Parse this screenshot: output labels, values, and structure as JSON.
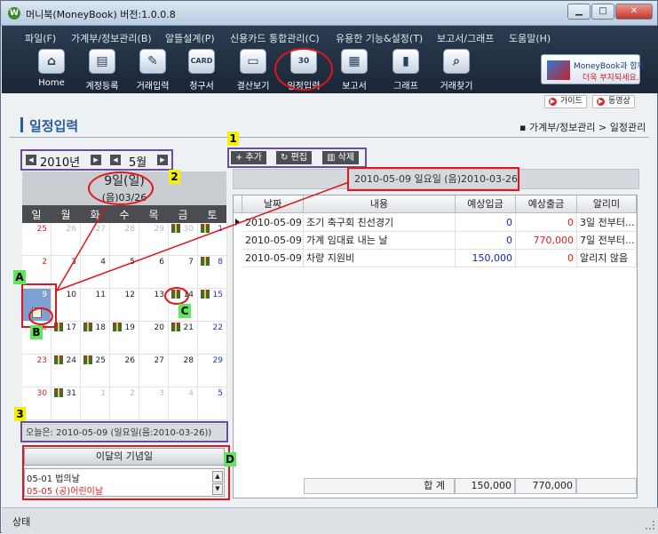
{
  "window": {
    "title": "머니북(MoneyBook) 버전:1.0.0.8",
    "app_icon": "W",
    "controls": [
      "minimize-icon",
      "maximize-icon",
      "close-icon"
    ]
  },
  "menu": [
    "파일(F)",
    "가계부/정보관리(B)",
    "알뜰설계(P)",
    "신용카드 통합관리(C)",
    "유용한 기능&설정(T)",
    "보고서/그래프",
    "도움말(H)"
  ],
  "toolbar": [
    {
      "label": "Home",
      "icon": "home-icon"
    },
    {
      "label": "계정등록",
      "icon": "account-register-icon"
    },
    {
      "label": "거래입력",
      "icon": "transaction-entry-icon"
    },
    {
      "label": "청구서",
      "icon": "card-bill-icon",
      "glyph": "CARD"
    },
    {
      "label": "결산보기",
      "icon": "settlement-icon"
    },
    {
      "label": "일정입력",
      "icon": "schedule-icon",
      "glyph": "30"
    },
    {
      "label": "보고서",
      "icon": "report-icon"
    },
    {
      "label": "그래프",
      "icon": "graph-icon"
    },
    {
      "label": "거래찾기",
      "icon": "search-icon"
    }
  ],
  "brand": {
    "line1": "MoneyBook과 함께",
    "line2": "더욱 부자되세요."
  },
  "help": {
    "guide": "가이드",
    "video": "동영상"
  },
  "page": {
    "title": "일정입력",
    "breadcrumb": "▪ 가계부/정보관리 > 일정관리"
  },
  "calendar": {
    "year": "2010년",
    "month": "5월",
    "selected_day": "9일(일)",
    "selected_lunar": "(음)03/26",
    "weekdays": [
      "일",
      "월",
      "화",
      "수",
      "목",
      "금",
      "토"
    ],
    "weeks": [
      [
        {
          "d": "25",
          "o": true
        },
        {
          "d": "26",
          "o": true
        },
        {
          "d": "27",
          "o": true
        },
        {
          "d": "28",
          "o": true
        },
        {
          "d": "29",
          "o": true
        },
        {
          "d": "30",
          "o": true,
          "g": true
        },
        {
          "d": "1",
          "g": true
        }
      ],
      [
        {
          "d": "2"
        },
        {
          "d": "3"
        },
        {
          "d": "4"
        },
        {
          "d": "5"
        },
        {
          "d": "6"
        },
        {
          "d": "7"
        },
        {
          "d": "8",
          "g": true
        }
      ],
      [
        {
          "d": "9",
          "s": true,
          "memo": true
        },
        {
          "d": "10"
        },
        {
          "d": "11"
        },
        {
          "d": "12"
        },
        {
          "d": "13"
        },
        {
          "d": "14",
          "g": true
        },
        {
          "d": "15",
          "g": true
        }
      ],
      [
        {
          "d": "16"
        },
        {
          "d": "17",
          "g": true
        },
        {
          "d": "18",
          "g": true
        },
        {
          "d": "19",
          "g": true
        },
        {
          "d": "20"
        },
        {
          "d": "21",
          "g": true
        },
        {
          "d": "22"
        }
      ],
      [
        {
          "d": "23"
        },
        {
          "d": "24",
          "g": true
        },
        {
          "d": "25",
          "g": true
        },
        {
          "d": "26"
        },
        {
          "d": "27"
        },
        {
          "d": "28"
        },
        {
          "d": "29"
        }
      ],
      [
        {
          "d": "30"
        },
        {
          "d": "31",
          "g": true
        },
        {
          "d": "1",
          "o": true
        },
        {
          "d": "2",
          "o": true
        },
        {
          "d": "3",
          "o": true
        },
        {
          "d": "4",
          "o": true
        },
        {
          "d": "5",
          "o": true
        }
      ]
    ],
    "today": "오늘은:  2010-05-09  (일요일(음:2010-03-26))"
  },
  "anniversaries": {
    "title": "이달의 기념일",
    "items": [
      {
        "text": "05-01 법의날",
        "color": "#222222"
      },
      {
        "text": "05-05 (공)어린이날",
        "color": "#d81f1f"
      }
    ]
  },
  "actions": {
    "add": "+ 추가",
    "edit": "편집",
    "delete": "삭제"
  },
  "schedule": {
    "date_header": "2010-05-09 일요일 (음)2010-03-26",
    "columns": [
      "날짜",
      "내용",
      "예상입금",
      "예상출금",
      "알리미"
    ],
    "rows": [
      {
        "date": "2010-05-09",
        "content": "조기 축구회 친선경기",
        "in": "0",
        "out": "0",
        "alarm": "3일 전부터..."
      },
      {
        "date": "2010-05-09",
        "content": "가계 임대료 내는 날",
        "in": "0",
        "out": "770,000",
        "alarm": "7일 전부터..."
      },
      {
        "date": "2010-05-09",
        "content": "차량 지원비",
        "in": "150,000",
        "out": "0",
        "alarm": "알리지 않음"
      }
    ],
    "total_label": "합 계",
    "total_in": "150,000",
    "total_out": "770,000"
  },
  "status": "상태",
  "annotations": {
    "tag1": "1",
    "tag2": "2",
    "tag3": "3",
    "tagA": "A",
    "tagB": "B",
    "tagC": "C",
    "tagD": "D",
    "annotation_color": "#e3141b",
    "marker_color": "#f5f000",
    "marker_green": "#5fe65f"
  },
  "colors": {
    "accent": "#2a5b9d",
    "selected": "#7e9fd2",
    "income": "#1324c9",
    "expense": "#d81f1f"
  }
}
